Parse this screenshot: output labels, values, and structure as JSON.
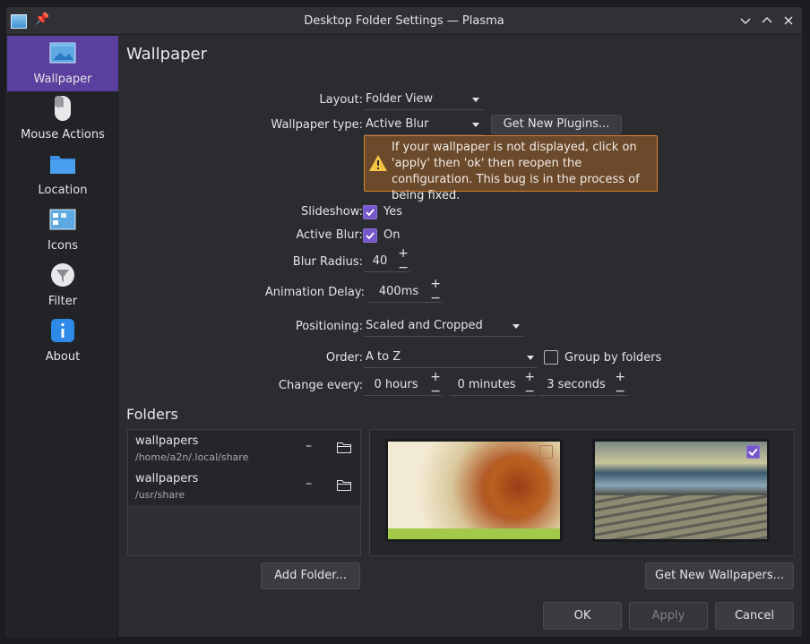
{
  "window": {
    "title": "Desktop Folder Settings — Plasma"
  },
  "sidebar": {
    "items": [
      {
        "label": "Wallpaper",
        "icon": "wallpaper-icon",
        "active": true
      },
      {
        "label": "Mouse Actions",
        "icon": "mouse-icon",
        "active": false
      },
      {
        "label": "Location",
        "icon": "folder-icon",
        "active": false
      },
      {
        "label": "Icons",
        "icon": "icons-icon",
        "active": false
      },
      {
        "label": "Filter",
        "icon": "filter-icon",
        "active": false
      },
      {
        "label": "About",
        "icon": "info-icon",
        "active": false
      }
    ]
  },
  "page": {
    "title": "Wallpaper",
    "layout_label": "Layout:",
    "layout_value": "Folder View",
    "wallpaper_type_label": "Wallpaper type:",
    "wallpaper_type_value": "Active Blur",
    "get_plugins_label": "Get New Plugins...",
    "warning_text": "If your wallpaper is not displayed, click on 'apply' then 'ok' then reopen the configuration. This bug is in the process of being fixed.",
    "slideshow_label": "Slideshow:",
    "slideshow_value": "Yes",
    "slideshow_checked": true,
    "active_blur_label": "Active Blur:",
    "active_blur_value": "On",
    "active_blur_checked": true,
    "blur_radius_label": "Blur Radius:",
    "blur_radius_value": "40",
    "animation_delay_label": "Animation Delay:",
    "animation_delay_value": "400ms",
    "positioning_label": "Positioning:",
    "positioning_value": "Scaled and Cropped",
    "order_label": "Order:",
    "order_value": "A to Z",
    "group_by_folders_label": "Group by folders",
    "group_by_folders_checked": false,
    "change_every_label": "Change every:",
    "hours_value": "0 hours",
    "minutes_value": "0 minutes",
    "seconds_value": "3 seconds",
    "folders_title": "Folders",
    "folders": [
      {
        "name": "wallpapers",
        "path": "/home/a2n/.local/share"
      },
      {
        "name": "wallpapers",
        "path": "/usr/share"
      }
    ],
    "add_folder_label": "Add Folder...",
    "get_wallpapers_label": "Get New Wallpapers..."
  },
  "thumbnails": [
    {
      "checked": false
    },
    {
      "checked": true
    }
  ],
  "footer": {
    "ok_label": "OK",
    "apply_label": "Apply",
    "cancel_label": "Cancel"
  },
  "colors": {
    "accent": "#7657c9",
    "sidebar_active": "#5a3f9e",
    "warning_border": "#d9822e",
    "warning_bg": "#6b4a2c"
  }
}
